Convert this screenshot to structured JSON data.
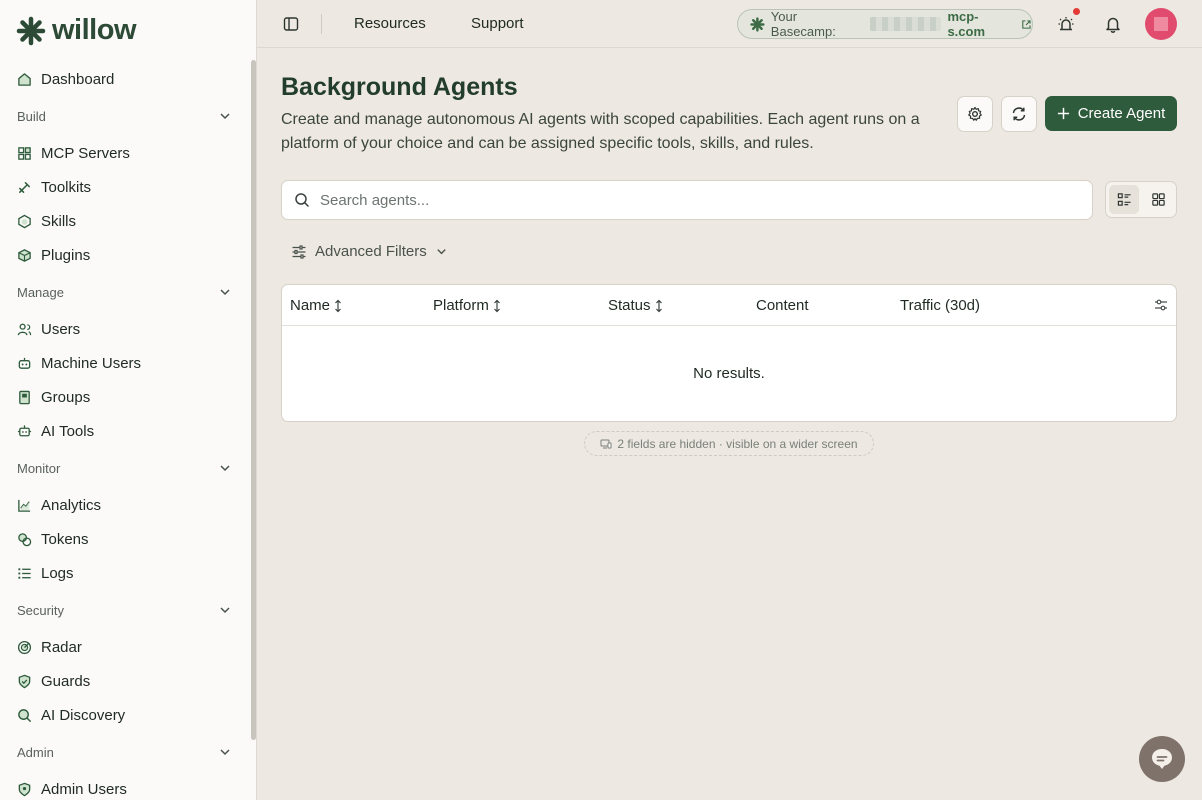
{
  "app": {
    "logo_text": "willow"
  },
  "sidebar": {
    "dashboard": "Dashboard",
    "sections": [
      {
        "title": "Build",
        "items": [
          "MCP Servers",
          "Toolkits",
          "Skills",
          "Plugins"
        ]
      },
      {
        "title": "Manage",
        "items": [
          "Users",
          "Machine Users",
          "Groups",
          "AI Tools"
        ]
      },
      {
        "title": "Monitor",
        "items": [
          "Analytics",
          "Tokens",
          "Logs"
        ]
      },
      {
        "title": "Security",
        "items": [
          "Radar",
          "Guards",
          "AI Discovery"
        ]
      },
      {
        "title": "Admin",
        "items": [
          "Admin Users"
        ]
      }
    ]
  },
  "topbar": {
    "resources": "Resources",
    "support": "Support",
    "basecamp_label": "Your Basecamp:",
    "basecamp_domain": "mcp-s.com"
  },
  "page": {
    "title": "Background Agents",
    "description": "Create and manage autonomous AI agents with scoped capabilities. Each agent runs on a platform of your choice and can be assigned specific tools, skills, and rules.",
    "create_label": "Create Agent",
    "search_placeholder": "Search agents...",
    "filters_label": "Advanced Filters",
    "columns": [
      "Name",
      "Platform",
      "Status",
      "Content",
      "Traffic (30d)"
    ],
    "empty_text": "No results.",
    "hidden_note": "2 fields are hidden · visible on a wider screen"
  },
  "colors": {
    "accent": "#2e5b3c",
    "background": "#ede8e1",
    "sidebar": "#fbfaf8",
    "notification": "#e53935",
    "avatar": "#e14b6e"
  }
}
